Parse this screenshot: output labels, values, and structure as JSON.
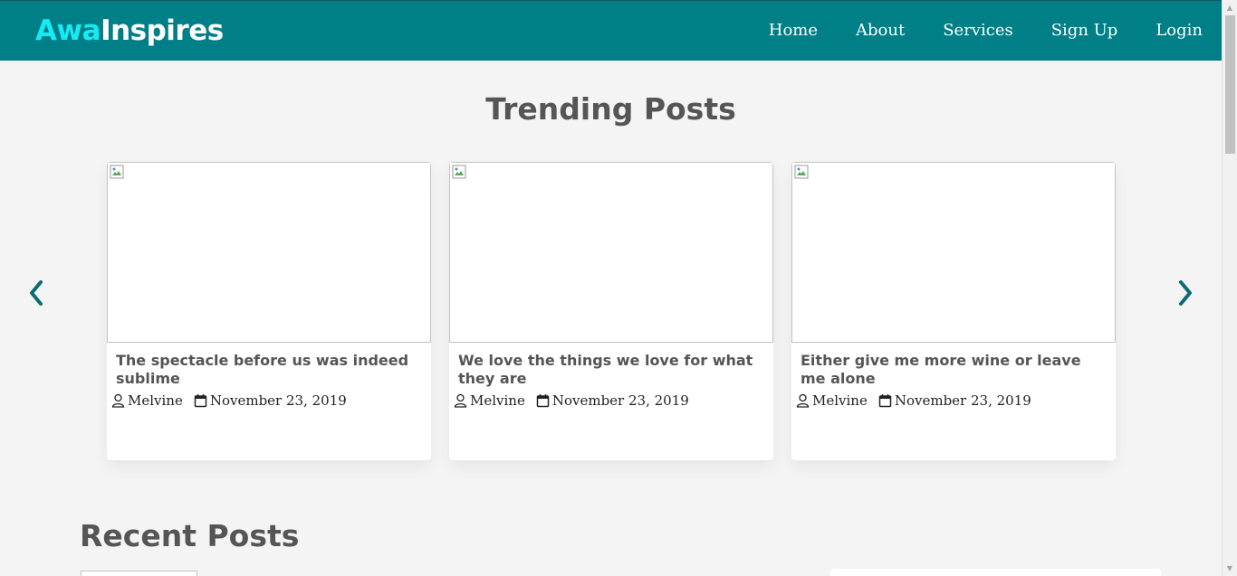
{
  "header": {
    "brand_part1": "Awa",
    "brand_part2": "Inspires",
    "nav": [
      {
        "label": "Home"
      },
      {
        "label": "About"
      },
      {
        "label": "Services"
      },
      {
        "label": "Sign Up"
      },
      {
        "label": "Login"
      }
    ]
  },
  "trending": {
    "title": "Trending Posts",
    "cards": [
      {
        "title": "The spectacle before us was indeed sublime",
        "author": "Melvine",
        "date": "November 23, 2019"
      },
      {
        "title": "We love the things we love for what they are",
        "author": "Melvine",
        "date": "November 23, 2019"
      },
      {
        "title": "Either give me more wine or leave me alone",
        "author": "Melvine",
        "date": "November 23, 2019"
      }
    ]
  },
  "recent": {
    "title": "Recent Posts"
  },
  "icons": {
    "prev": "chevron-left-icon",
    "next": "chevron-right-icon",
    "author": "user-icon",
    "date": "calendar-icon",
    "image": "broken-image-icon"
  },
  "colors": {
    "navbar": "#007f86",
    "brand_accent": "#18eaf4",
    "heading": "#555555",
    "arrow": "#0b6b73",
    "background": "#f4f4f4"
  }
}
